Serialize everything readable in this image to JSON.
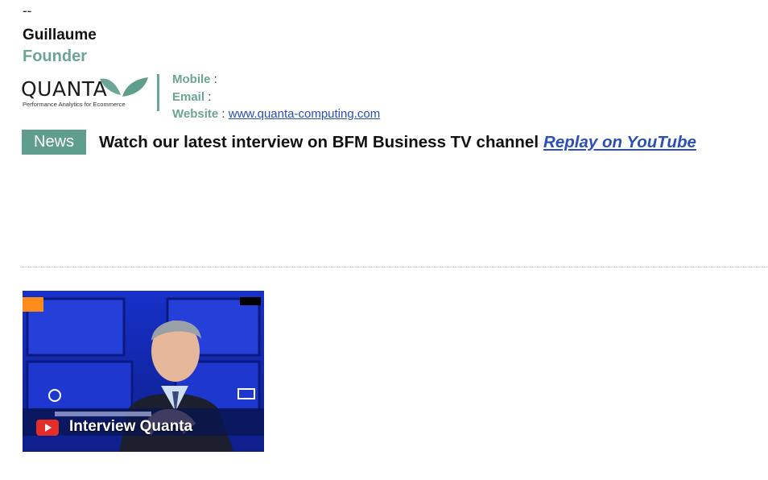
{
  "signature": {
    "separator": "--",
    "name": "Guillaume",
    "role": "Founder",
    "logo": {
      "word": "QUANTA",
      "tagline": "Performance Analytics for Ecommerce",
      "color": "#6aa596"
    },
    "contact": {
      "mobile_label": "Mobile",
      "email_label": "Email",
      "website_label": "Website",
      "website_url": "www.quanta-computing.com"
    }
  },
  "news": {
    "badge": "News",
    "text": "Watch our latest interview on BFM Business TV channel",
    "link": "Replay on YouTube"
  },
  "video": {
    "title": "Interview Quanta",
    "icon": "youtube-play-icon"
  },
  "colors": {
    "accent": "#6aa596",
    "badge": "#5f9d8d",
    "link": "#2a4fb5"
  }
}
